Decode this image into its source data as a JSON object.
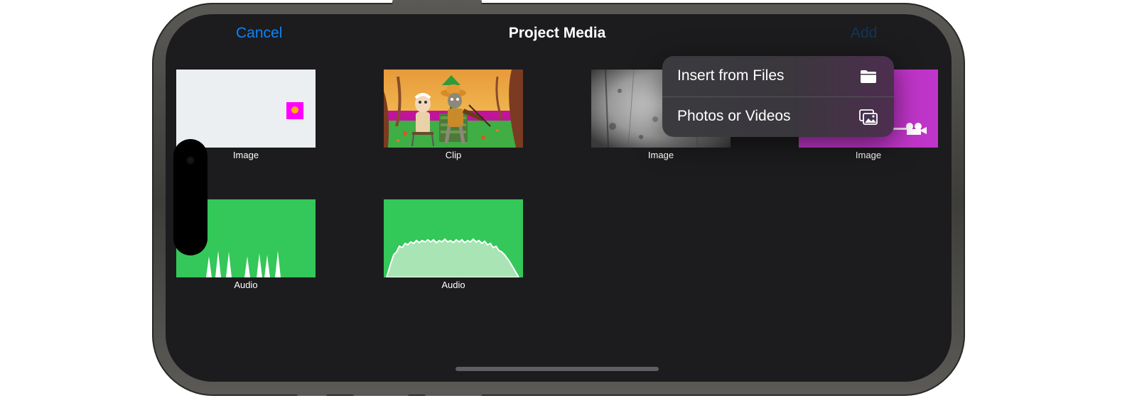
{
  "nav": {
    "cancel_label": "Cancel",
    "title": "Project Media",
    "add_label": "Add"
  },
  "media": [
    {
      "caption": "Image",
      "kind": "image-pink-square"
    },
    {
      "caption": "Clip",
      "kind": "clip-animated-violinists"
    },
    {
      "caption": "Image",
      "kind": "image-grey-texture"
    },
    {
      "caption": "Image",
      "kind": "image-magenta-logo"
    },
    {
      "caption": "Audio",
      "kind": "audio-spikes-waveform"
    },
    {
      "caption": "Audio",
      "kind": "audio-dense-waveform"
    }
  ],
  "add_menu": {
    "items": [
      {
        "label": "Insert from Files",
        "icon": "folder-icon"
      },
      {
        "label": "Photos or Videos",
        "icon": "photos-icon"
      }
    ]
  },
  "colors": {
    "accent": "#0a84ff",
    "screen_background": "#1c1c1e",
    "audio_green": "#34c759",
    "magenta": "#c035c9"
  }
}
